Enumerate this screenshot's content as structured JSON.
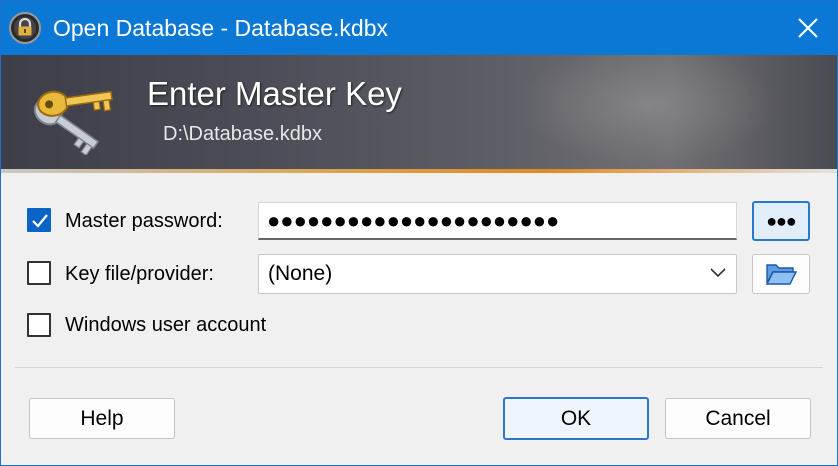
{
  "window": {
    "title": "Open Database - Database.kdbx",
    "close_icon": "close-icon",
    "app_icon": "keepass-lock-icon"
  },
  "banner": {
    "title": "Enter Master Key",
    "subtitle": "D:\\Database.kdbx",
    "icon": "keys-icon"
  },
  "form": {
    "master_password": {
      "checked": true,
      "label": "Master password:",
      "value": "●●●●●●●●●●●●●●●●●●●●●●",
      "reveal_label": "●●●"
    },
    "key_file": {
      "checked": false,
      "label": "Key file/provider:",
      "selected": "(None)",
      "browse_icon": "folder-open-icon"
    },
    "windows_account": {
      "checked": false,
      "label": "Windows user account"
    }
  },
  "buttons": {
    "help": "Help",
    "ok": "OK",
    "cancel": "Cancel"
  },
  "colors": {
    "titlebar": "#0a78d4",
    "accent": "#2a78c8",
    "checkbox_checked": "#0a64c8"
  }
}
